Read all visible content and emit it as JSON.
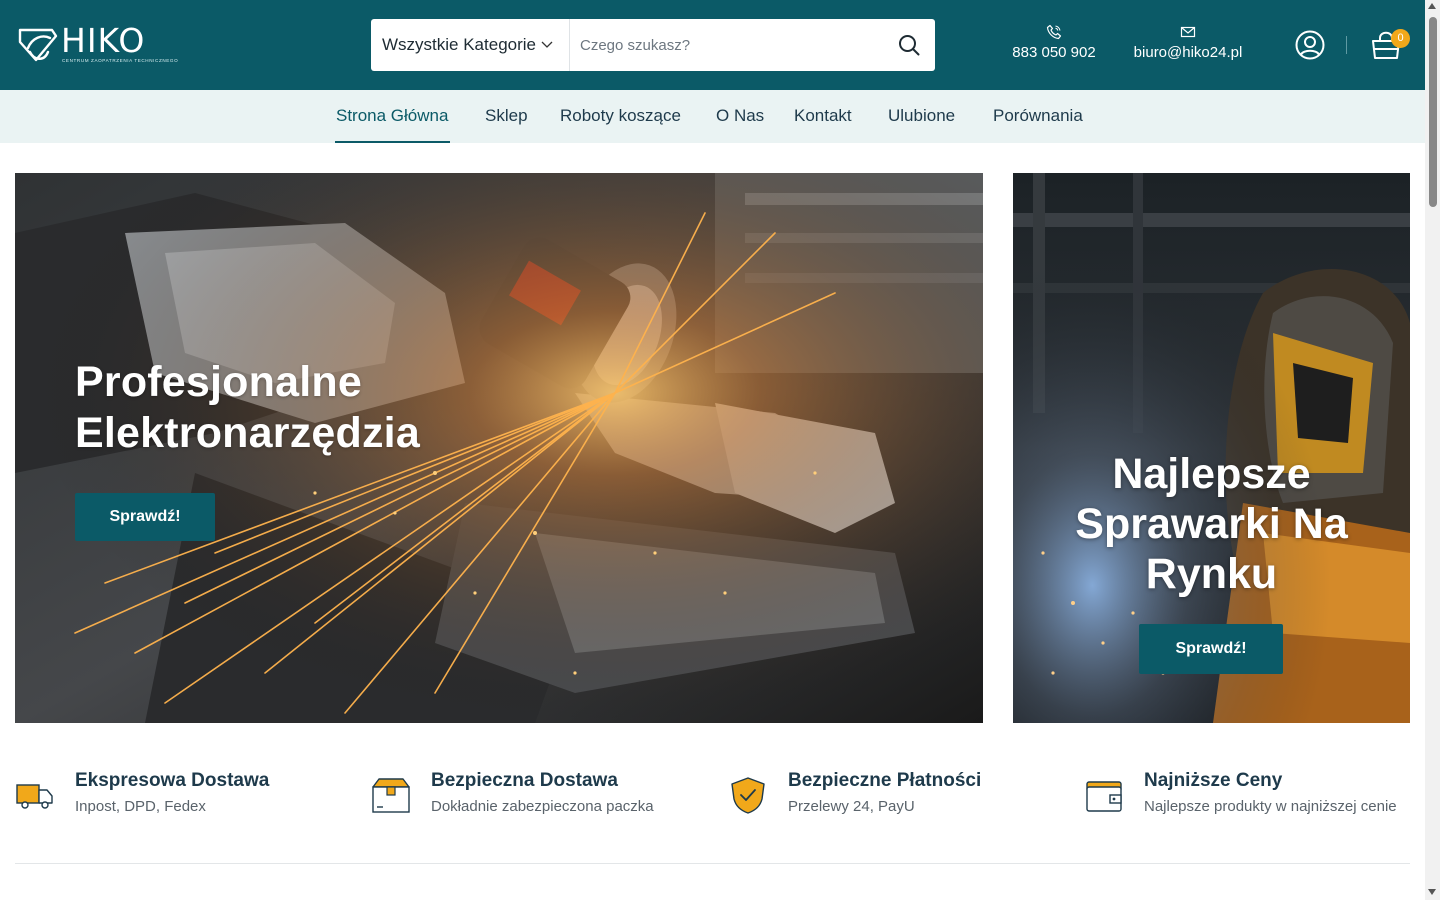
{
  "header": {
    "logo_text": "HIKO",
    "logo_subtitle": "CENTRUM ZAOPATRZENIA TECHNICZNEGO",
    "search": {
      "category_label": "Wszystkie Kategorie",
      "placeholder": "Czego szukasz?",
      "value": ""
    },
    "phone": "883 050 902",
    "email": "biuro@hiko24.pl",
    "cart_count": "0",
    "icons": {
      "phone": "phone-icon",
      "email": "envelope-icon",
      "user": "user-icon",
      "cart": "shopping-bag-icon",
      "search": "search-icon"
    }
  },
  "nav": {
    "items": [
      {
        "label": "Strona Główna",
        "active": true
      },
      {
        "label": "Sklep"
      },
      {
        "label": "Roboty koszące"
      },
      {
        "label": "O Nas"
      },
      {
        "label": "Kontakt"
      },
      {
        "label": "Ulubione"
      },
      {
        "label": "Porównania"
      }
    ]
  },
  "hero": {
    "left": {
      "title_line1": "Profesjonalne",
      "title_line2": "Elektronarzędzia",
      "button": "Sprawdź!"
    },
    "right": {
      "title_line1": "Najlepsze",
      "title_line2": "Sprawarki Na",
      "title_line3": "Rynku",
      "button": "Sprawdź!"
    }
  },
  "features": [
    {
      "title": "Ekspresowa Dostawa",
      "subtitle": "Inpost, DPD, Fedex",
      "icon": "delivery-truck-icon"
    },
    {
      "title": "Bezpieczna Dostawa",
      "subtitle": "Dokładnie zabezpieczona paczka",
      "icon": "package-box-icon"
    },
    {
      "title": "Bezpieczne Płatności",
      "subtitle": "Przelewy 24, PayU",
      "icon": "shield-check-icon"
    },
    {
      "title": "Najniższe Ceny",
      "subtitle": "Najlepsze produkty w najniższej cenie",
      "icon": "wallet-icon"
    }
  ],
  "colors": {
    "brand": "#0b5a67",
    "accent": "#f1a81a",
    "nav_bg": "#eaf3f3"
  }
}
